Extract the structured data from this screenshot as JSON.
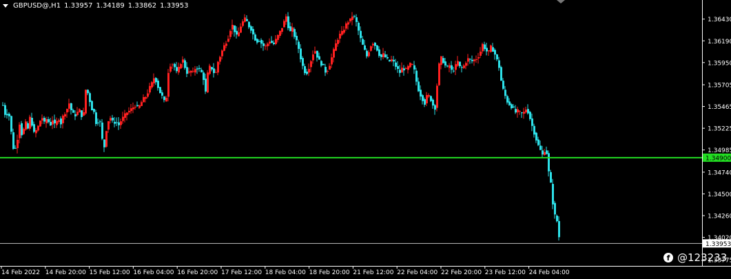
{
  "header": {
    "symbol": "GBPUSD@,H1",
    "open": "1.33957",
    "high": "1.34189",
    "low": "1.33862",
    "close": "1.33953"
  },
  "watermark": {
    "text": "@123233",
    "icon": "facebook-icon"
  },
  "colors": {
    "background": "#000000",
    "bull": "#ff2020",
    "bear": "#2de0e8",
    "support_line": "#22dd22",
    "bid_line": "#c0c0c0",
    "text": "#ffffff"
  },
  "chart_data": {
    "type": "candlestick",
    "symbol": "GBPUSD",
    "timeframe": "H1",
    "ylim": [
      1.3372,
      1.3658
    ],
    "y_ticks": [
      "1.36430",
      "1.36190",
      "1.35950",
      "1.35705",
      "1.35465",
      "1.35225",
      "1.34985",
      "1.34740",
      "1.34500",
      "1.34260",
      "1.34020",
      "1.33775"
    ],
    "x_ticks": [
      "14 Feb 2022",
      "14 Feb 20:00",
      "15 Feb 12:00",
      "16 Feb 04:00",
      "16 Feb 20:00",
      "17 Feb 12:00",
      "18 Feb 04:00",
      "18 Feb 20:00",
      "21 Feb 12:00",
      "22 Feb 04:00",
      "22 Feb 20:00",
      "23 Feb 12:00",
      "24 Feb 04:00"
    ],
    "horizontal_line": {
      "price": 1.349,
      "label": "1.34900"
    },
    "current_price": {
      "price": 1.33953,
      "label": "1.33953"
    },
    "bull_color": "#ff2020",
    "bear_color": "#2de0e8",
    "close_path": [
      [
        0,
        1.3548
      ],
      [
        4,
        1.3535
      ],
      [
        8,
        1.3542
      ],
      [
        12,
        1.3518
      ],
      [
        16,
        1.3495
      ],
      [
        20,
        1.3506
      ],
      [
        24,
        1.3528
      ],
      [
        28,
        1.3512
      ],
      [
        32,
        1.353
      ],
      [
        36,
        1.3522
      ],
      [
        40,
        1.3538
      ],
      [
        44,
        1.3516
      ],
      [
        48,
        1.352
      ],
      [
        52,
        1.3526
      ],
      [
        56,
        1.3536
      ],
      [
        60,
        1.3528
      ],
      [
        64,
        1.3534
      ],
      [
        68,
        1.3525
      ],
      [
        72,
        1.3532
      ],
      [
        76,
        1.3524
      ],
      [
        80,
        1.3535
      ],
      [
        84,
        1.3528
      ],
      [
        88,
        1.3538
      ],
      [
        92,
        1.3542
      ],
      [
        96,
        1.355
      ],
      [
        100,
        1.354
      ],
      [
        104,
        1.3536
      ],
      [
        108,
        1.354
      ],
      [
        112,
        1.3543
      ],
      [
        116,
        1.353
      ],
      [
        120,
        1.3565
      ],
      [
        124,
        1.356
      ],
      [
        128,
        1.3545
      ],
      [
        132,
        1.354
      ],
      [
        136,
        1.3525
      ],
      [
        140,
        1.3535
      ],
      [
        144,
        1.351
      ],
      [
        146,
        1.3492
      ],
      [
        148,
        1.3512
      ],
      [
        152,
        1.353
      ],
      [
        156,
        1.3534
      ],
      [
        160,
        1.3528
      ],
      [
        164,
        1.353
      ],
      [
        168,
        1.3526
      ],
      [
        172,
        1.3532
      ],
      [
        176,
        1.3536
      ],
      [
        180,
        1.354
      ],
      [
        184,
        1.3542
      ],
      [
        188,
        1.3545
      ],
      [
        192,
        1.3548
      ],
      [
        196,
        1.3544
      ],
      [
        200,
        1.355
      ],
      [
        204,
        1.3555
      ],
      [
        208,
        1.3558
      ],
      [
        212,
        1.3566
      ],
      [
        216,
        1.3572
      ],
      [
        220,
        1.358
      ],
      [
        224,
        1.357
      ],
      [
        228,
        1.3562
      ],
      [
        232,
        1.3556
      ],
      [
        236,
        1.3548
      ],
      [
        240,
        1.3585
      ],
      [
        244,
        1.3595
      ],
      [
        248,
        1.3592
      ],
      [
        252,
        1.3584
      ],
      [
        256,
        1.359
      ],
      [
        260,
        1.36
      ],
      [
        264,
        1.359
      ],
      [
        268,
        1.3582
      ],
      [
        272,
        1.3586
      ],
      [
        276,
        1.3584
      ],
      [
        280,
        1.359
      ],
      [
        284,
        1.3588
      ],
      [
        288,
        1.3584
      ],
      [
        292,
        1.3575
      ],
      [
        294,
        1.3562
      ],
      [
        296,
        1.358
      ],
      [
        300,
        1.359
      ],
      [
        304,
        1.3588
      ],
      [
        308,
        1.358
      ],
      [
        312,
        1.3596
      ],
      [
        316,
        1.3604
      ],
      [
        320,
        1.3612
      ],
      [
        324,
        1.3618
      ],
      [
        328,
        1.3625
      ],
      [
        332,
        1.3638
      ],
      [
        336,
        1.363
      ],
      [
        340,
        1.3622
      ],
      [
        344,
        1.3634
      ],
      [
        348,
        1.364
      ],
      [
        352,
        1.3644
      ],
      [
        356,
        1.3636
      ],
      [
        360,
        1.3632
      ],
      [
        364,
        1.3624
      ],
      [
        368,
        1.3618
      ],
      [
        372,
        1.362
      ],
      [
        376,
        1.3615
      ],
      [
        380,
        1.3612
      ],
      [
        384,
        1.3616
      ],
      [
        388,
        1.362
      ],
      [
        392,
        1.3614
      ],
      [
        396,
        1.362
      ],
      [
        400,
        1.3626
      ],
      [
        404,
        1.3632
      ],
      [
        408,
        1.364
      ],
      [
        410,
        1.365
      ],
      [
        412,
        1.3642
      ],
      [
        416,
        1.3628
      ],
      [
        420,
        1.3632
      ],
      [
        424,
        1.3622
      ],
      [
        428,
        1.3614
      ],
      [
        432,
        1.36
      ],
      [
        436,
        1.3588
      ],
      [
        440,
        1.3582
      ],
      [
        444,
        1.359
      ],
      [
        448,
        1.36
      ],
      [
        452,
        1.361
      ],
      [
        456,
        1.3602
      ],
      [
        460,
        1.3595
      ],
      [
        464,
        1.3592
      ],
      [
        468,
        1.3585
      ],
      [
        472,
        1.3588
      ],
      [
        476,
        1.3598
      ],
      [
        480,
        1.3608
      ],
      [
        484,
        1.3618
      ],
      [
        488,
        1.3625
      ],
      [
        492,
        1.3628
      ],
      [
        496,
        1.3634
      ],
      [
        500,
        1.364
      ],
      [
        504,
        1.3642
      ],
      [
        508,
        1.3648
      ],
      [
        512,
        1.3642
      ],
      [
        516,
        1.363
      ],
      [
        520,
        1.3618
      ],
      [
        524,
        1.361
      ],
      [
        528,
        1.3602
      ],
      [
        532,
        1.361
      ],
      [
        536,
        1.3618
      ],
      [
        540,
        1.3614
      ],
      [
        544,
        1.3608
      ],
      [
        548,
        1.36
      ],
      [
        552,
        1.3604
      ],
      [
        556,
        1.36
      ],
      [
        560,
        1.3596
      ],
      [
        564,
        1.3598
      ],
      [
        568,
        1.3594
      ],
      [
        572,
        1.3588
      ],
      [
        576,
        1.3584
      ],
      [
        580,
        1.359
      ],
      [
        584,
        1.3586
      ],
      [
        588,
        1.359
      ],
      [
        592,
        1.3594
      ],
      [
        596,
        1.359
      ],
      [
        600,
        1.3574
      ],
      [
        604,
        1.3562
      ],
      [
        608,
        1.3556
      ],
      [
        612,
        1.355
      ],
      [
        616,
        1.356
      ],
      [
        620,
        1.3556
      ],
      [
        624,
        1.3548
      ],
      [
        628,
        1.3544
      ],
      [
        630,
        1.357
      ],
      [
        632,
        1.359
      ],
      [
        636,
        1.36
      ],
      [
        640,
        1.3595
      ],
      [
        644,
        1.3588
      ],
      [
        648,
        1.3592
      ],
      [
        652,
        1.3584
      ],
      [
        656,
        1.359
      ],
      [
        660,
        1.3596
      ],
      [
        664,
        1.3588
      ],
      [
        668,
        1.359
      ],
      [
        672,
        1.3596
      ],
      [
        676,
        1.36
      ],
      [
        680,
        1.3596
      ],
      [
        684,
        1.3598
      ],
      [
        688,
        1.36
      ],
      [
        692,
        1.3605
      ],
      [
        696,
        1.3615
      ],
      [
        700,
        1.361
      ],
      [
        704,
        1.3605
      ],
      [
        708,
        1.3612
      ],
      [
        712,
        1.3608
      ],
      [
        716,
        1.36
      ],
      [
        720,
        1.359
      ],
      [
        724,
        1.357
      ],
      [
        728,
        1.356
      ],
      [
        732,
        1.3552
      ],
      [
        736,
        1.3548
      ],
      [
        740,
        1.3545
      ],
      [
        744,
        1.354
      ],
      [
        748,
        1.3542
      ],
      [
        752,
        1.3538
      ],
      [
        756,
        1.354
      ],
      [
        760,
        1.3545
      ],
      [
        764,
        1.3536
      ],
      [
        768,
        1.3525
      ],
      [
        772,
        1.3515
      ],
      [
        776,
        1.3505
      ],
      [
        780,
        1.3498
      ],
      [
        782,
        1.349
      ],
      [
        784,
        1.3496
      ],
      [
        788,
        1.35
      ],
      [
        790,
        1.349
      ],
      [
        792,
        1.3474
      ],
      [
        794,
        1.347
      ],
      [
        796,
        1.3452
      ],
      [
        798,
        1.344
      ],
      [
        800,
        1.3428
      ],
      [
        804,
        1.342
      ],
      [
        806,
        1.341
      ],
      [
        808,
        1.3395
      ]
    ]
  }
}
